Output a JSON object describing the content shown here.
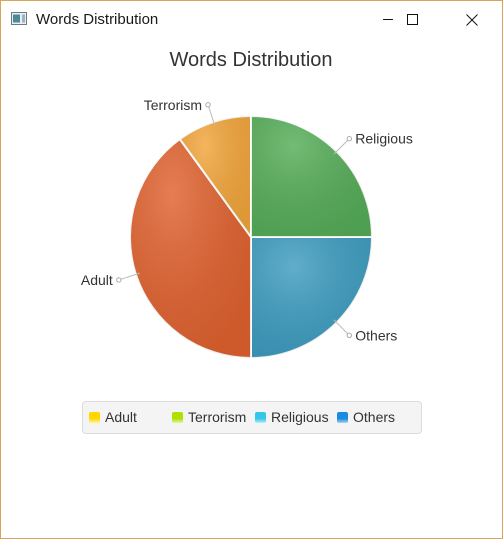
{
  "window": {
    "title": "Words Distribution"
  },
  "chart_data": {
    "type": "pie",
    "title": "Words Distribution",
    "slices": [
      {
        "label": "Others",
        "value": 25,
        "color": "#3d9cc0"
      },
      {
        "label": "Adult",
        "value": 40,
        "color": "#e0612e"
      },
      {
        "label": "Terrorism",
        "value": 10,
        "color": "#f2a53a"
      },
      {
        "label": "Religious",
        "value": 25,
        "color": "#55ad58"
      }
    ],
    "start_angle_deg": 0,
    "direction": "clockwise",
    "legend": {
      "position": "bottom",
      "items": [
        {
          "label": "Adult",
          "color": "#ffd700"
        },
        {
          "label": "Terrorism",
          "color": "#b0e000"
        },
        {
          "label": "Religious",
          "color": "#33c8e8"
        },
        {
          "label": "Others",
          "color": "#1a8be0"
        }
      ]
    }
  }
}
